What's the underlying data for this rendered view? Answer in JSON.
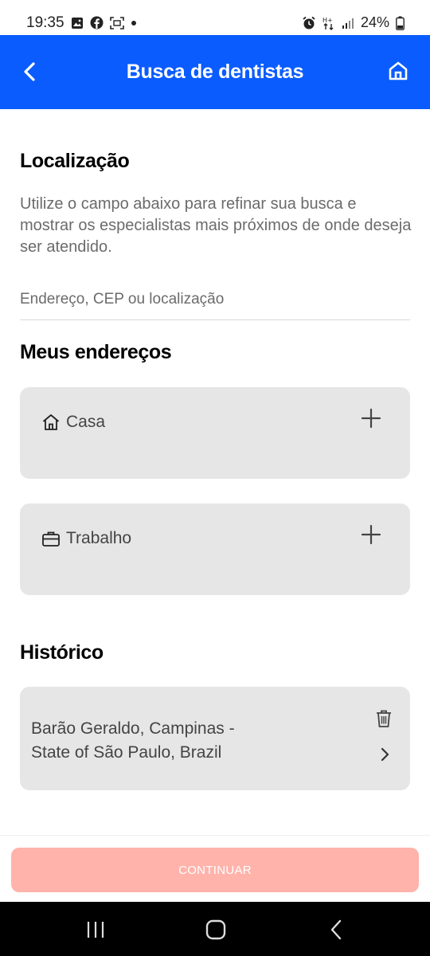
{
  "status_bar": {
    "time": "19:35",
    "battery": "24%",
    "left_icons": [
      "gallery-icon",
      "facebook-icon",
      "screenshot-icon",
      "dot-icon"
    ],
    "right_icons": [
      "alarm-icon",
      "data-icon",
      "signal-icon",
      "battery-icon"
    ]
  },
  "app_bar": {
    "title": "Busca de dentistas",
    "back_icon": "chevron-left-icon",
    "home_icon": "home-icon",
    "background": "#0a5cff"
  },
  "location": {
    "title": "Localização",
    "description": "Utilize o campo abaixo para refinar sua busca e mostrar os especialistas mais próximos de onde deseja ser atendido.",
    "placeholder": "Endereço, CEP ou localização",
    "value": ""
  },
  "my_addresses": {
    "title": "Meus endereços",
    "items": [
      {
        "label": "Casa",
        "icon": "home-outline-icon",
        "action_icon": "plus-icon"
      },
      {
        "label": "Trabalho",
        "icon": "briefcase-icon",
        "action_icon": "plus-icon"
      }
    ]
  },
  "history": {
    "title": "Histórico",
    "items": [
      {
        "address": "Barão Geraldo, Campinas - State of São Paulo, Brazil",
        "delete_icon": "trash-icon",
        "open_icon": "chevron-right-icon"
      }
    ]
  },
  "footer": {
    "continue_label": "CONTINUAR",
    "continue_color": "#ffb3ab",
    "continue_enabled": false
  },
  "nav_bar": {
    "buttons": [
      "recents-icon",
      "home-button-icon",
      "back-icon"
    ]
  }
}
